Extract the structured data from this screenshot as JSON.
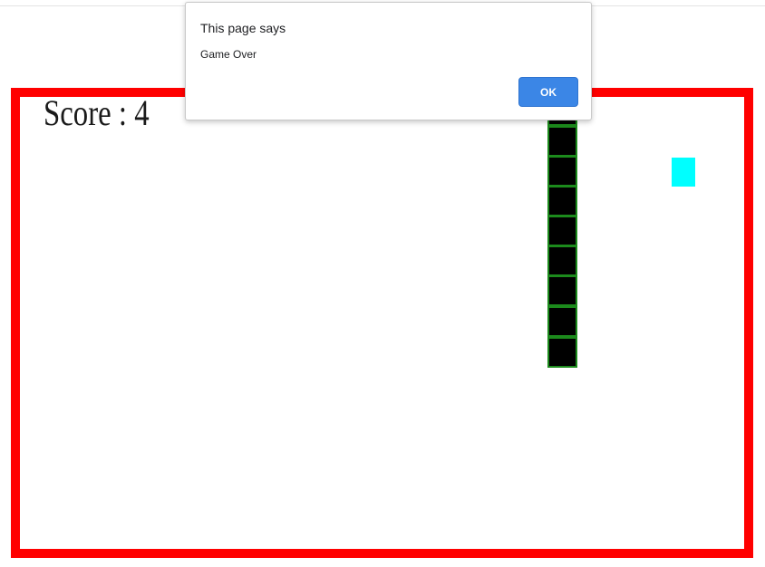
{
  "game": {
    "score_text": "Score : 4",
    "board_border_color": "#ff0000",
    "snake_fill_color": "#000000",
    "snake_outline_color": "#1c8a1c",
    "food_color": "#00ffff"
  },
  "dialog": {
    "title": "This page says",
    "message": "Game Over",
    "ok_label": "OK",
    "button_color": "#3b86e6"
  }
}
